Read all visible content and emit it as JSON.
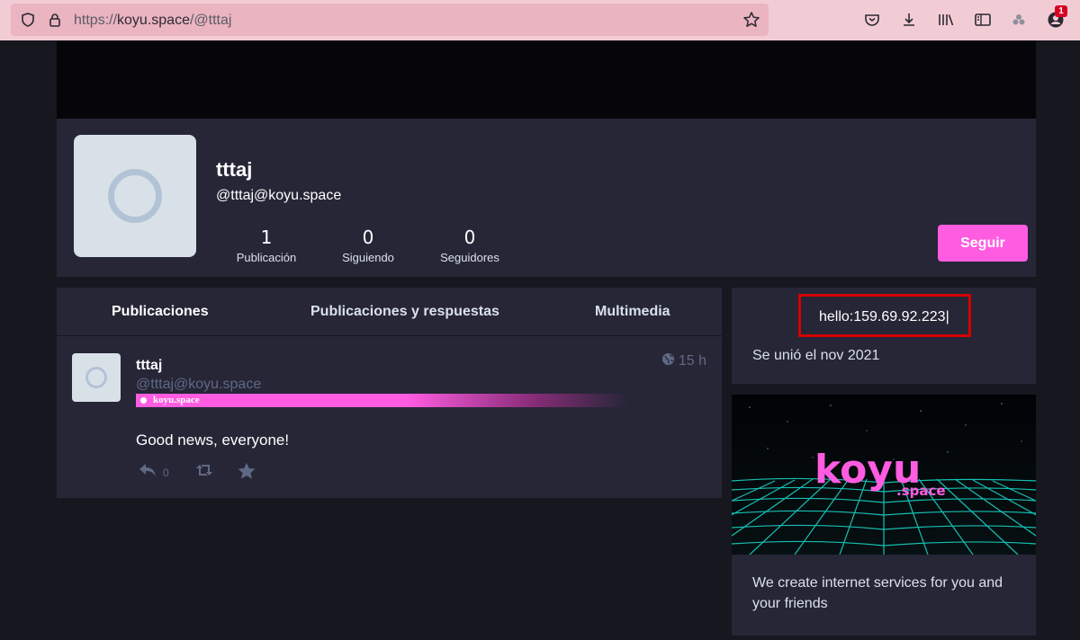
{
  "browser": {
    "url_scheme": "https://",
    "url_host": "koyu.space",
    "url_path": "/@tttaj",
    "notification_badge": "1"
  },
  "profile": {
    "display_name": "tttaj",
    "acct": "@tttaj@koyu.space",
    "stats": [
      {
        "value": "1",
        "label": "Publicación"
      },
      {
        "value": "0",
        "label": "Siguiendo"
      },
      {
        "value": "0",
        "label": "Seguidores"
      }
    ],
    "follow_label": "Seguir"
  },
  "tabs": [
    {
      "label": "Publicaciones"
    },
    {
      "label": "Publicaciones y respuestas"
    },
    {
      "label": "Multimedia"
    }
  ],
  "status": {
    "display_name": "tttaj",
    "acct": "@tttaj@koyu.space",
    "time": "15 h",
    "instance_badge": "koyu.space",
    "content": "Good news, everyone!",
    "reply_count": "0"
  },
  "sidebar": {
    "field_value": "hello:159.69.92.223|",
    "joined": "Se unió el nov 2021",
    "promo_logo": "koyu",
    "promo_logo_sub": ".space",
    "promo_text": "We create internet services for you and your friends"
  },
  "colors": {
    "accent": "#ff5ce1",
    "panel": "#262637",
    "background": "#17171f",
    "highlight_box": "#d60000"
  }
}
